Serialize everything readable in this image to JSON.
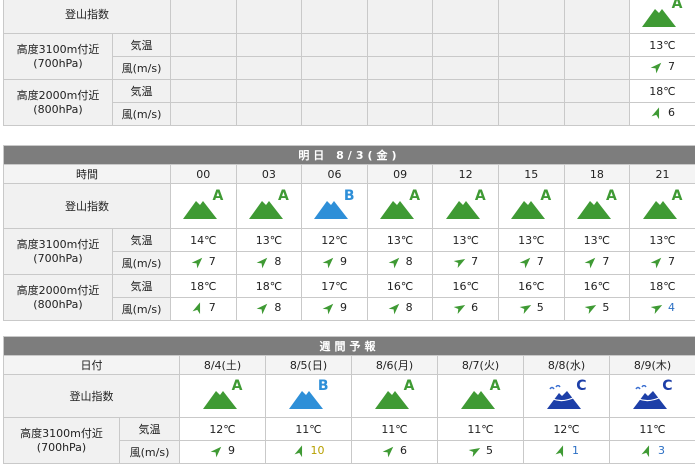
{
  "colors": {
    "green": "#3f9a34",
    "blue": "#2e8fd8",
    "navy": "#1d3fa8",
    "yellow": "#b7a000",
    "lightblue": "#2b6fc4"
  },
  "labels": {
    "climb_index": "登山指数",
    "alt3100": "高度3100m付近",
    "hpa700": "(700hPa)",
    "alt2000": "高度2000m付近",
    "hpa800": "(800hPa)",
    "temp": "気温",
    "wind": "風(m/s)",
    "time": "時間",
    "date": "日付"
  },
  "today": {
    "index": {
      "grade": "A",
      "color": "green"
    },
    "t3100": "13℃",
    "w3100": "7",
    "t2000": "18℃",
    "w2000": "6"
  },
  "tomorrow": {
    "header": "明日 8/3(金)",
    "hours": [
      "00",
      "03",
      "06",
      "09",
      "12",
      "15",
      "18",
      "21"
    ],
    "index": [
      {
        "grade": "A",
        "color": "green"
      },
      {
        "grade": "A",
        "color": "green"
      },
      {
        "grade": "B",
        "color": "blue"
      },
      {
        "grade": "A",
        "color": "green"
      },
      {
        "grade": "A",
        "color": "green"
      },
      {
        "grade": "A",
        "color": "green"
      },
      {
        "grade": "A",
        "color": "green"
      },
      {
        "grade": "A",
        "color": "green"
      }
    ],
    "t3100": [
      "14℃",
      "13℃",
      "12℃",
      "13℃",
      "13℃",
      "13℃",
      "13℃",
      "13℃"
    ],
    "w3100": [
      "7",
      "8",
      "9",
      "8",
      "7",
      "7",
      "7",
      "7"
    ],
    "t2000": [
      "18℃",
      "18℃",
      "17℃",
      "16℃",
      "16℃",
      "16℃",
      "16℃",
      "18℃"
    ],
    "w2000": [
      "7",
      "8",
      "9",
      "8",
      "6",
      "5",
      "5",
      "4"
    ]
  },
  "weekly": {
    "header": "週間予報",
    "dates": [
      "8/4(土)",
      "8/5(日)",
      "8/6(月)",
      "8/7(火)",
      "8/8(水)",
      "8/9(木)"
    ],
    "index": [
      {
        "grade": "A",
        "color": "green"
      },
      {
        "grade": "B",
        "color": "blue"
      },
      {
        "grade": "A",
        "color": "green"
      },
      {
        "grade": "A",
        "color": "green"
      },
      {
        "grade": "C",
        "color": "navy"
      },
      {
        "grade": "C",
        "color": "navy"
      }
    ],
    "t3100": [
      "12℃",
      "11℃",
      "11℃",
      "11℃",
      "12℃",
      "11℃"
    ],
    "w3100": [
      "9",
      "10",
      "6",
      "5",
      "1",
      "3"
    ]
  }
}
